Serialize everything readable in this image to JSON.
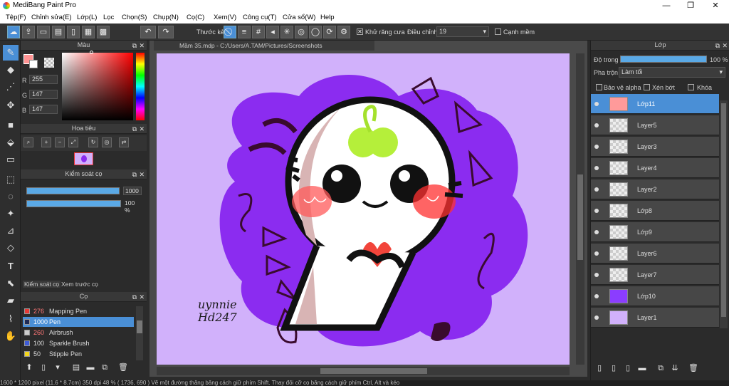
{
  "window": {
    "title": "MediBang Paint Pro",
    "min_label": "—",
    "max_label": "❐",
    "close_label": "✕"
  },
  "menu": [
    "Tệp(F)",
    "Chỉnh sửa(E)",
    "Lớp(L)",
    "Lọc",
    "Chọn(S)",
    "Chụp(N)",
    "Cọ(C)",
    "Xem(V)",
    "Công cụ(T)",
    "Cửa sổ(W)",
    "Help"
  ],
  "toolbar": {
    "ruler_label": "Thước kẻ",
    "antialias_label": "Khử răng cưa",
    "correction_label": "Điều chỉnh",
    "correction_value": "19",
    "snap_label": "Cạnh mềm"
  },
  "color_panel": {
    "title": "Màu",
    "r_label": "R",
    "r": "255",
    "g_label": "G",
    "g": "147",
    "b_label": "B",
    "b": "147"
  },
  "navigator": {
    "title": "Hoa tiêu"
  },
  "brush_control": {
    "title": "Kiểm soát cọ",
    "size": "1000",
    "opacity": "100 %",
    "tab1": "Kiểm soát cọ",
    "tab2": "Xem trước cọ"
  },
  "brush_panel": {
    "title": "Cọ",
    "items": [
      {
        "size": "276",
        "name": "Mapping Pen",
        "color": "#e53935"
      },
      {
        "size": "1000",
        "name": "Pen",
        "color": "#1e2a55"
      },
      {
        "size": "260",
        "name": "Airbrush",
        "color": "#cccccc"
      },
      {
        "size": "100",
        "name": "Sparkle Brush",
        "color": "#3e5bd6"
      },
      {
        "size": "50",
        "name": "Stipple Pen",
        "color": "#f2d51c"
      }
    ]
  },
  "document": {
    "tab": "Mầm 35.mdp - C:/Users/A.TAM/Pictures/Screenshots",
    "signature": "uynnie\nHd247"
  },
  "layer_panel": {
    "title": "Lớp",
    "opacity_label": "Độ trong",
    "opacity_value": "100 %",
    "opacity_fraction": 1.0,
    "blend_label": "Pha trộn",
    "blend_value": "Làm tối",
    "protect_alpha": "Bảo vệ alpha",
    "clipping": "Xén bớt",
    "lock": "Khóa",
    "layers": [
      {
        "name": "Lớp11",
        "selected": true,
        "thumb": "#ff9a9a"
      },
      {
        "name": "Layer5",
        "selected": false,
        "thumb": ""
      },
      {
        "name": "Layer3",
        "selected": false,
        "thumb": ""
      },
      {
        "name": "Layer4",
        "selected": false,
        "thumb": ""
      },
      {
        "name": "Layer2",
        "selected": false,
        "thumb": ""
      },
      {
        "name": "Lớp8",
        "selected": false,
        "thumb": ""
      },
      {
        "name": "Lớp9",
        "selected": false,
        "thumb": ""
      },
      {
        "name": "Layer6",
        "selected": false,
        "thumb": ""
      },
      {
        "name": "Layer7",
        "selected": false,
        "thumb": ""
      },
      {
        "name": "Lớp10",
        "selected": false,
        "thumb": "#8b3dff"
      },
      {
        "name": "Layer1",
        "selected": false,
        "thumb": "#d1b1fb"
      }
    ]
  },
  "status": "1600 * 1200 pixel   (11.6 * 8.7cm)   350 dpi   48 %   ( 1736, 690 )   Vẽ một đường thẳng bằng cách giữ phím Shift. Thay đổi cỡ cọ bằng cách giữ phím Ctrl, Alt và kéo",
  "colors": {
    "accent": "#4a8fd6",
    "canvas_bg": "#d1b1fb",
    "fg_color": "#ff9393",
    "purple_blob": "#8b2cf0"
  }
}
